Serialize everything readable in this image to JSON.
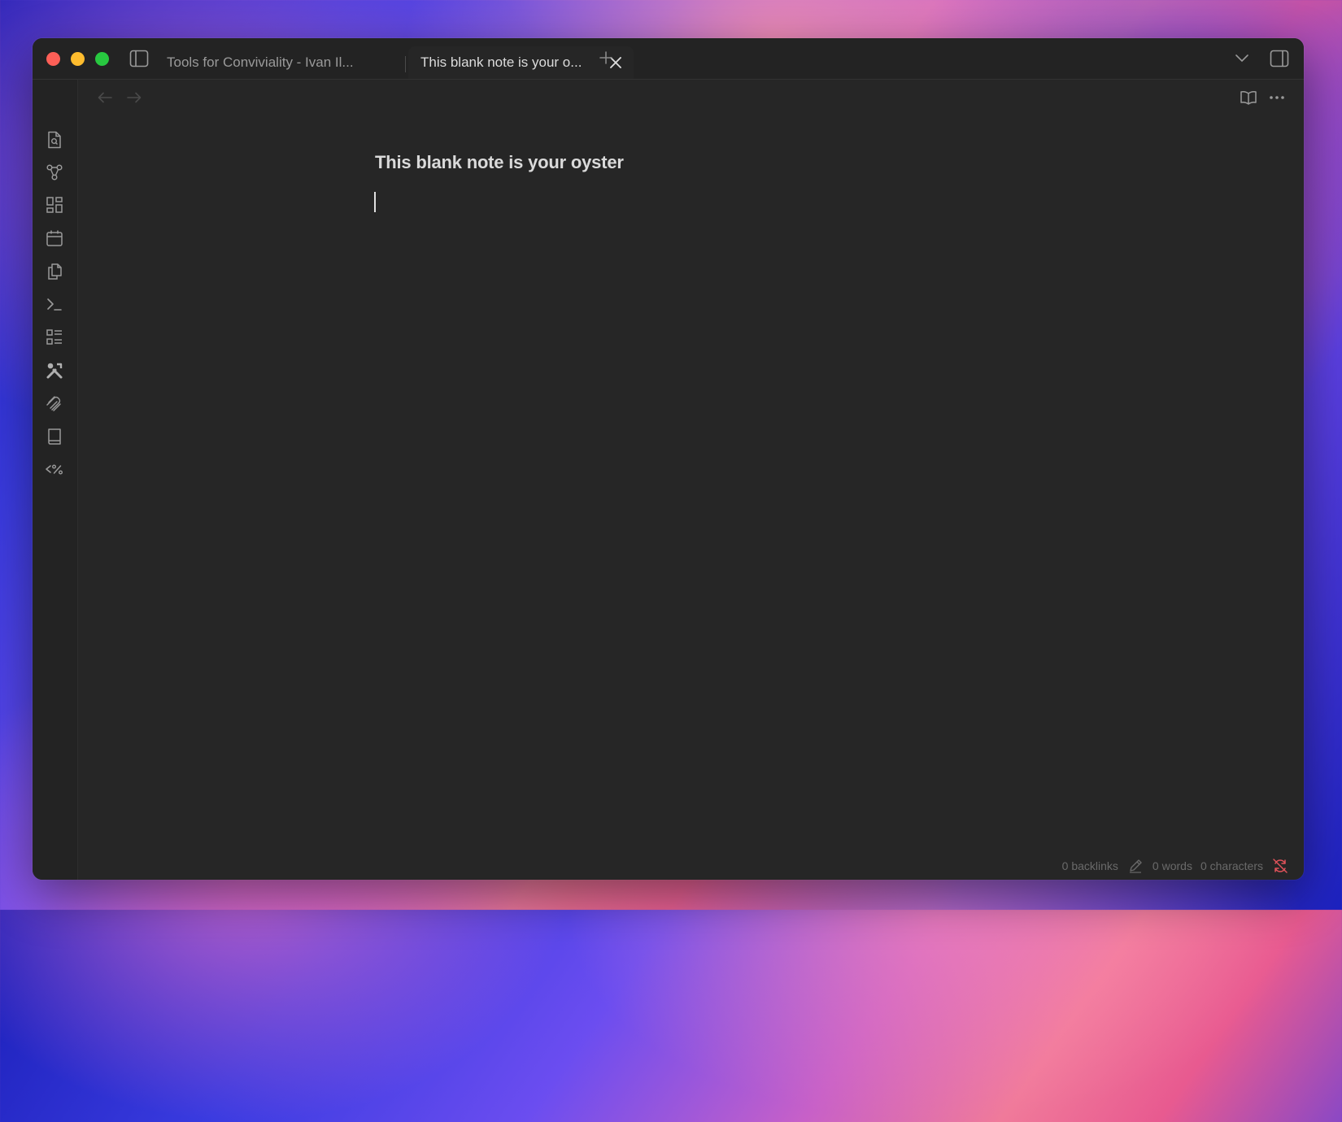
{
  "tabs": [
    {
      "label": "Tools for Conviviality - Ivan Il...",
      "active": false
    },
    {
      "label": "This blank note is your o...",
      "active": true
    }
  ],
  "note": {
    "title": "This blank note is your oyster"
  },
  "status_bar": {
    "backlinks": "0 backlinks",
    "words": "0 words",
    "characters": "0 characters"
  },
  "ribbon_icons": [
    "file-search-icon",
    "graph-icon",
    "canvas-icon",
    "calendar-icon",
    "copy-icon",
    "terminal-icon",
    "outline-icon",
    "tools-icon",
    "link-icon",
    "book-icon",
    "templater-icon"
  ],
  "colors": {
    "accent_red": "#e0525a",
    "window_bg": "#262626",
    "titlebar_bg": "#232323"
  }
}
